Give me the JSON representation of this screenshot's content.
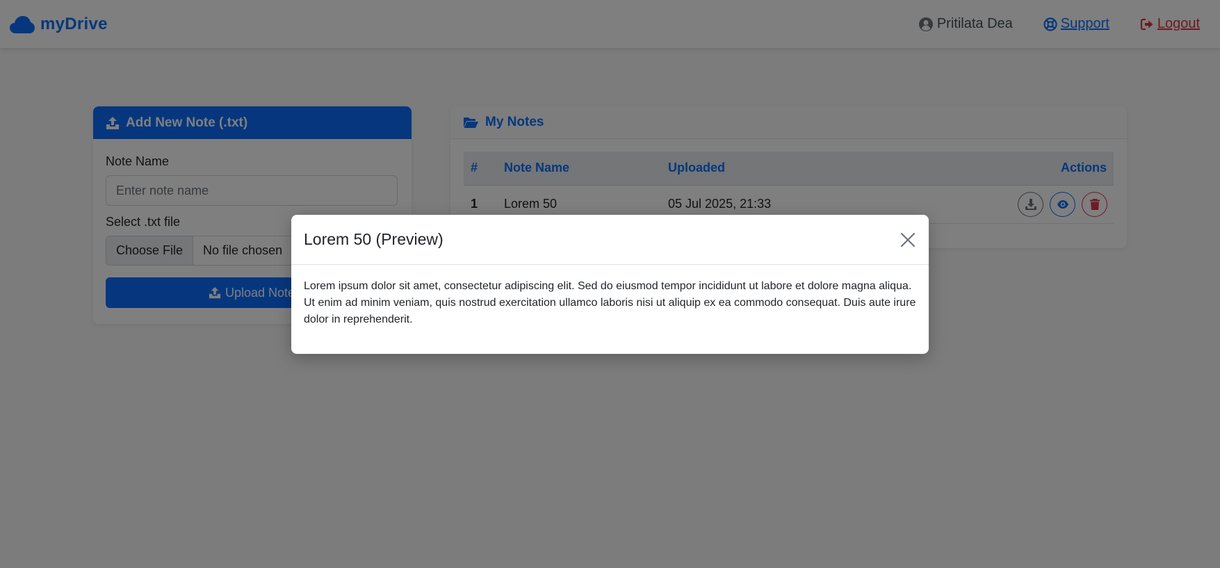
{
  "navbar": {
    "brand": "myDrive",
    "user_name": "Pritilata Dea",
    "support_label": "Support",
    "logout_label": "Logout"
  },
  "upload_card": {
    "title": "Add New Note (.txt)",
    "note_name_label": "Note Name",
    "note_name_placeholder": "Enter note name",
    "file_label": "Select .txt file",
    "choose_file_label": "Choose File",
    "no_file_label": "No file chosen",
    "upload_button_label": "Upload Note"
  },
  "notes_card": {
    "title": "My Notes",
    "columns": [
      "#",
      "Note Name",
      "Uploaded",
      "Actions"
    ],
    "rows": [
      {
        "num": "1",
        "name": "Lorem 50",
        "uploaded": "05 Jul 2025, 21:33"
      }
    ]
  },
  "modal": {
    "title": "Lorem 50 (Preview)",
    "body": "Lorem ipsum dolor sit amet, consectetur adipiscing elit. Sed do eiusmod tempor incididunt ut labore et dolore magna aliqua. Ut enim ad minim veniam, quis nostrud exercitation ullamco laboris nisi ut aliquip ex ea commodo consequat. Duis aute irure dolor in reprehenderit."
  },
  "icons": {
    "brand": "cloud-icon",
    "user": "user-circle-icon",
    "support": "lifebuoy-icon",
    "logout": "sign-out-icon",
    "upload": "upload-icon",
    "folder": "folder-open-icon",
    "download": "download-icon",
    "view": "eye-icon",
    "delete": "trash-icon",
    "close": "close-icon"
  },
  "colors": {
    "primary": "#0d6efd",
    "danger": "#dc3545",
    "secondary": "#6c757d"
  }
}
